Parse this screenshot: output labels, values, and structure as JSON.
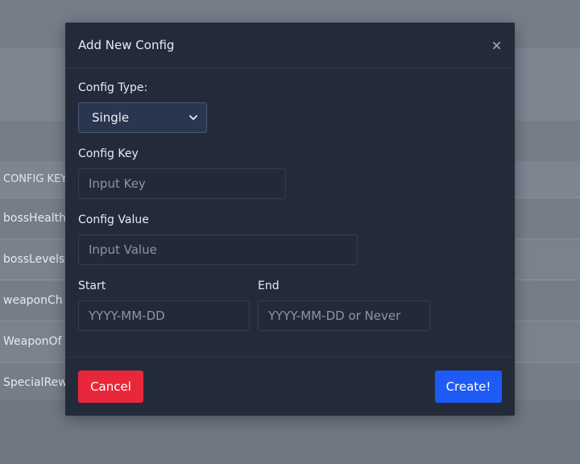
{
  "background": {
    "table_header": "CONFIG KEY",
    "rows": [
      "bossHealth",
      "bossLevels",
      "weaponCh",
      "WeaponOf",
      "SpecialRew"
    ]
  },
  "modal": {
    "title": "Add New Config",
    "close_icon": "close-icon",
    "config_type": {
      "label": "Config Type:",
      "selected": "Single"
    },
    "config_key": {
      "label": "Config Key",
      "placeholder": "Input Key"
    },
    "config_value": {
      "label": "Config Value",
      "placeholder": "Input Value"
    },
    "start": {
      "label": "Start",
      "placeholder": "YYYY-MM-DD"
    },
    "end": {
      "label": "End",
      "placeholder": "YYYY-MM-DD or Never"
    },
    "cancel_label": "Cancel",
    "create_label": "Create!"
  },
  "colors": {
    "modal_bg": "#232b3b",
    "cancel": "#e8283a",
    "create": "#1e5af5"
  }
}
